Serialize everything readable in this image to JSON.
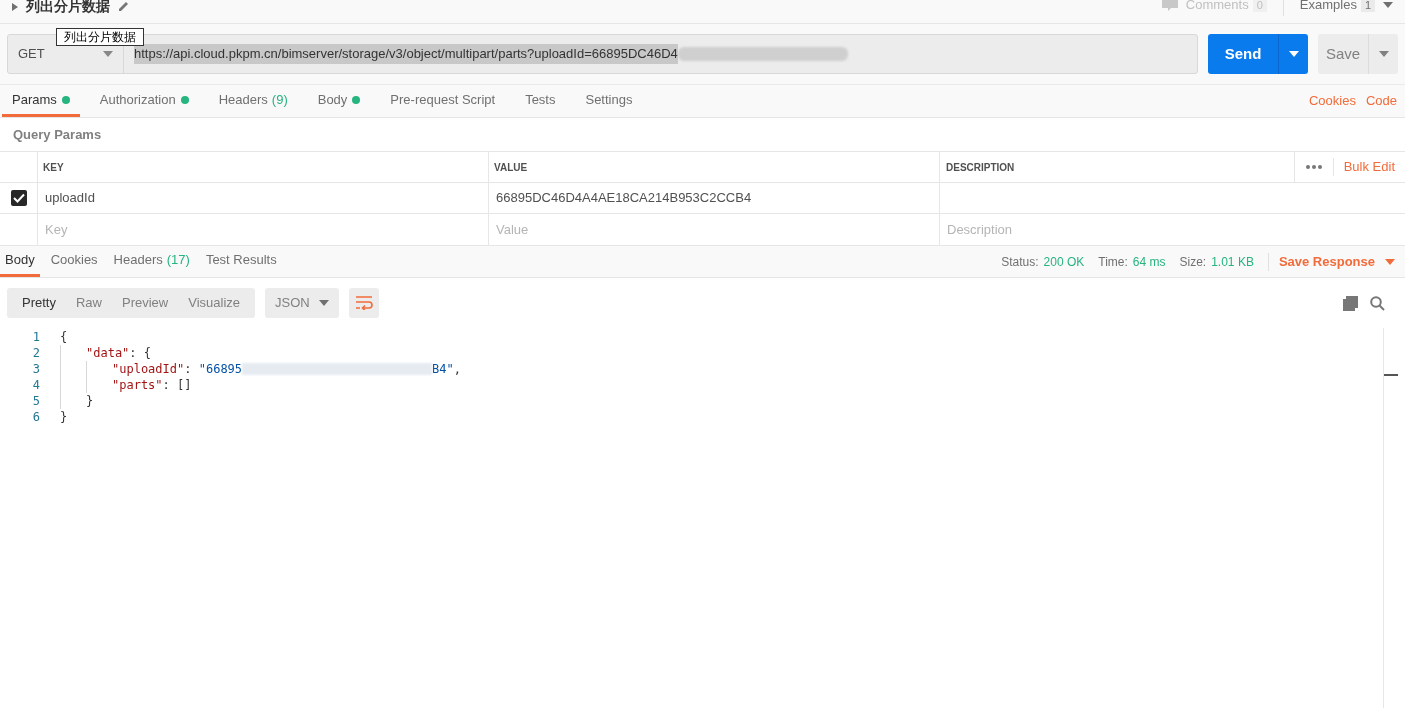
{
  "request": {
    "title": "列出分片数据",
    "tooltip": "列出分片数据",
    "method": "GET",
    "url": "https://api.cloud.pkpm.cn/bimserver/storage/v3/object/multipart/parts?uploadId=66895DC46D4",
    "url_redacted": true,
    "send": "Send",
    "save": "Save"
  },
  "header_right": {
    "comments": "Comments",
    "comments_count": "0",
    "examples": "Examples",
    "examples_count": "1"
  },
  "tabs": [
    {
      "label": "Params",
      "dot": true,
      "selected": true
    },
    {
      "label": "Authorization",
      "dot": true,
      "selected": false
    },
    {
      "label": "Headers",
      "dot": false,
      "count": "(9)",
      "selected": false
    },
    {
      "label": "Body",
      "dot": true,
      "selected": false
    },
    {
      "label": "Pre-request Script",
      "dot": false,
      "selected": false
    },
    {
      "label": "Tests",
      "dot": false,
      "selected": false
    },
    {
      "label": "Settings",
      "dot": false,
      "selected": false
    }
  ],
  "tab_links": [
    "Cookies",
    "Code"
  ],
  "query_params": {
    "title": "Query Params",
    "columns": [
      "KEY",
      "VALUE",
      "DESCRIPTION"
    ],
    "bulk_edit": "Bulk Edit",
    "rows": [
      {
        "checked": true,
        "key": "uploadId",
        "value": "66895DC46D4A4AE18CA214B953C2CCB4",
        "description": ""
      }
    ],
    "new_row": [
      {
        "placeholder": "Key"
      },
      {
        "placeholder": "Value"
      },
      {
        "placeholder": "Description"
      }
    ]
  },
  "response_tabs": [
    {
      "label": "Body",
      "selected": true
    },
    {
      "label": "Cookies",
      "selected": false
    },
    {
      "label": "Headers",
      "count": "(17)",
      "selected": false
    },
    {
      "label": "Test Results",
      "selected": false
    }
  ],
  "response_meta": [
    {
      "label": "Status:",
      "value": "200 OK"
    },
    {
      "label": "Time:",
      "value": "64 ms"
    },
    {
      "label": "Size:",
      "value": "1.01 KB"
    }
  ],
  "save_response": "Save Response",
  "view_modes": [
    {
      "label": "Pretty",
      "selected": true
    },
    {
      "label": "Raw",
      "selected": false
    },
    {
      "label": "Preview",
      "selected": false
    },
    {
      "label": "Visualize",
      "selected": false
    }
  ],
  "format": "JSON",
  "code_lines": [
    {
      "number": "1",
      "tokens": [
        {
          "kind": "punct",
          "text": "{"
        }
      ],
      "children": [
        {
          "number": "2",
          "tokens": [
            {
              "kind": "key",
              "text": "\"data\""
            },
            {
              "kind": "punct",
              "text": ": {"
            }
          ],
          "children": [
            {
              "number": "3",
              "tokens": [
                {
                  "kind": "key",
                  "text": "\"uploadId\""
                },
                {
                  "kind": "punct",
                  "text": ": "
                },
                {
                  "kind": "string",
                  "text": "\"66895"
                },
                {
                  "kind": "redacted"
                },
                {
                  "kind": "string",
                  "text": "B4\""
                },
                {
                  "kind": "punct",
                  "text": ","
                }
              ]
            },
            {
              "number": "4",
              "tokens": [
                {
                  "kind": "key",
                  "text": "\"parts\""
                },
                {
                  "kind": "punct",
                  "text": ": []"
                }
              ]
            }
          ]
        },
        {
          "number": "5",
          "tokens": [
            {
              "kind": "punct",
              "text": "}"
            }
          ]
        }
      ]
    },
    {
      "number": "6",
      "tokens": [
        {
          "kind": "punct",
          "text": "}"
        }
      ]
    }
  ]
}
